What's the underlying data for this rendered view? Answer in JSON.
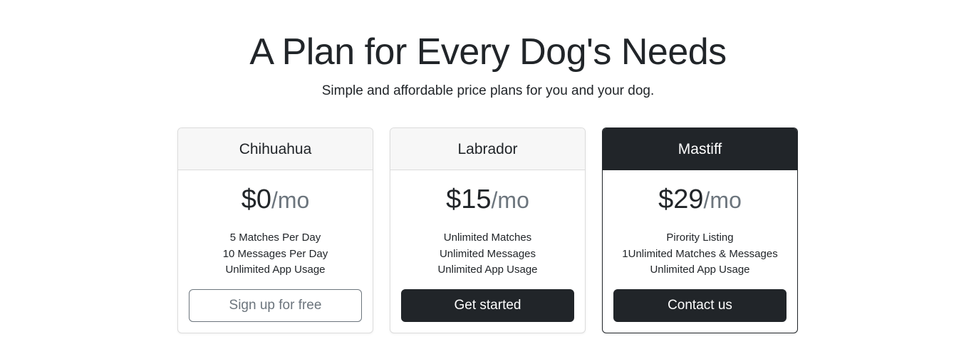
{
  "hero": {
    "title": "A Plan for Every Dog's Needs",
    "subtitle": "Simple and affordable price plans for you and your dog."
  },
  "plans": [
    {
      "name": "Chihuahua",
      "price": "$0",
      "period": "/mo",
      "features": [
        "5 Matches Per Day",
        "10 Messages Per Day",
        "Unlimited App Usage"
      ],
      "button_label": "Sign up for free",
      "button_style": "outline"
    },
    {
      "name": "Labrador",
      "price": "$15",
      "period": "/mo",
      "features": [
        "Unlimited Matches",
        "Unlimited Messages",
        "Unlimited App Usage"
      ],
      "button_label": "Get started",
      "button_style": "solid"
    },
    {
      "name": "Mastiff",
      "price": "$29",
      "period": "/mo",
      "features": [
        "Pirority Listing",
        "1Unlimited Matches & Messages",
        "Unlimited App Usage"
      ],
      "button_label": "Contact us",
      "button_style": "solid"
    }
  ],
  "colors": {
    "dark": "#212529",
    "muted": "#6c757d",
    "header_bg": "#f7f7f7",
    "border": "#dcdcdc"
  }
}
